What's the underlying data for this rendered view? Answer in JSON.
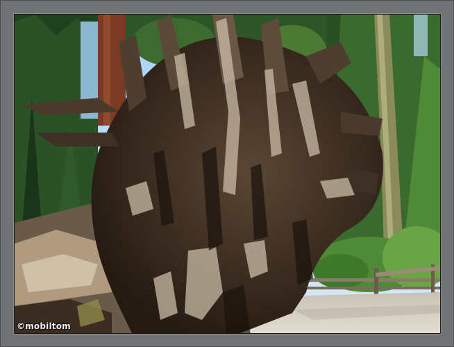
{
  "photo": {
    "subject": "fallen-sequoia-root-ball",
    "watermark": "©mobiltom"
  },
  "colors": {
    "frame": "#707274",
    "sky": "#9cc7ef",
    "forest_dark": "#1f3a1c",
    "forest_light": "#6fa047",
    "wood_dark": "#3a2a1e",
    "wood_light": "#cfc4b2",
    "ground": "#d8d2c6"
  }
}
